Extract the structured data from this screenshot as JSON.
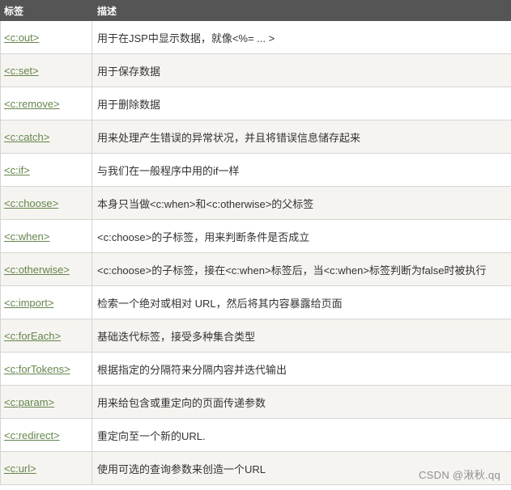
{
  "table": {
    "headers": [
      "标签",
      "描述"
    ],
    "rows": [
      {
        "tag": "<c:out>",
        "desc": "用于在JSP中显示数据，就像<%= ... >"
      },
      {
        "tag": "<c:set>",
        "desc": "用于保存数据"
      },
      {
        "tag": "<c:remove>",
        "desc": "用于删除数据"
      },
      {
        "tag": "<c:catch>",
        "desc": "用来处理产生错误的异常状况，并且将错误信息储存起来"
      },
      {
        "tag": "<c:if>",
        "desc": "与我们在一般程序中用的if一样"
      },
      {
        "tag": "<c:choose>",
        "desc": "本身只当做<c:when>和<c:otherwise>的父标签"
      },
      {
        "tag": "<c:when>",
        "desc": "<c:choose>的子标签，用来判断条件是否成立"
      },
      {
        "tag": "<c:otherwise>",
        "desc": "<c:choose>的子标签，接在<c:when>标签后，当<c:when>标签判断为false时被执行"
      },
      {
        "tag": "<c:import>",
        "desc": "检索一个绝对或相对 URL，然后将其内容暴露给页面"
      },
      {
        "tag": "<c:forEach>",
        "desc": "基础迭代标签，接受多种集合类型"
      },
      {
        "tag": "<c:forTokens>",
        "desc": "根据指定的分隔符来分隔内容并迭代输出"
      },
      {
        "tag": "<c:param>",
        "desc": "用来给包含或重定向的页面传递参数"
      },
      {
        "tag": "<c:redirect>",
        "desc": "重定向至一个新的URL."
      },
      {
        "tag": "<c:url>",
        "desc": "使用可选的查询参数来创造一个URL"
      }
    ]
  },
  "watermark": "CSDN @湫秋.qq",
  "colors": {
    "header_bg": "#555555",
    "link": "#64854c",
    "row_alt": "#f6f4f0"
  }
}
